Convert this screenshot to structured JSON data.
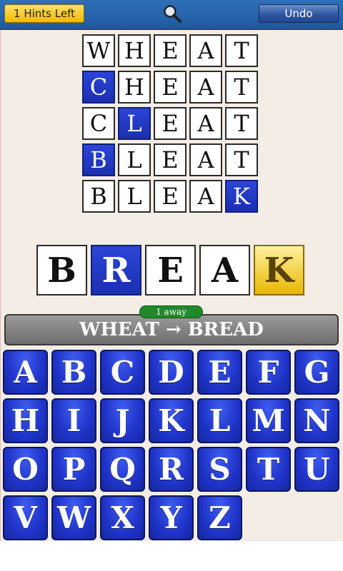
{
  "toolbar": {
    "hints_label": "1 Hints Left",
    "search_icon": "search-icon",
    "undo_label": "Undo"
  },
  "ladder": [
    {
      "letters": [
        "W",
        "H",
        "E",
        "A",
        "T"
      ],
      "changed_index": null
    },
    {
      "letters": [
        "C",
        "H",
        "E",
        "A",
        "T"
      ],
      "changed_index": 0
    },
    {
      "letters": [
        "C",
        "L",
        "E",
        "A",
        "T"
      ],
      "changed_index": 1
    },
    {
      "letters": [
        "B",
        "L",
        "E",
        "A",
        "T"
      ],
      "changed_index": 0
    },
    {
      "letters": [
        "B",
        "L",
        "E",
        "A",
        "K"
      ],
      "changed_index": 4
    }
  ],
  "current_word": {
    "letters": [
      "B",
      "R",
      "E",
      "A",
      "K"
    ],
    "changed_index": 1,
    "hint_index": 4
  },
  "status": {
    "away_label": "1 away",
    "target_label": "WHEAT → BREAD"
  },
  "keyboard": {
    "rows": [
      [
        "A",
        "B",
        "C",
        "D",
        "E",
        "F",
        "G"
      ],
      [
        "H",
        "I",
        "J",
        "K",
        "L",
        "M",
        "N"
      ],
      [
        "O",
        "P",
        "Q",
        "R",
        "S",
        "T",
        "U"
      ],
      [
        "V",
        "W",
        "X",
        "Y",
        "Z"
      ]
    ]
  },
  "colors": {
    "changed_tile": "#1f33c8",
    "hint_tile": "#e8b800",
    "away_pill": "#1f8a2a"
  }
}
